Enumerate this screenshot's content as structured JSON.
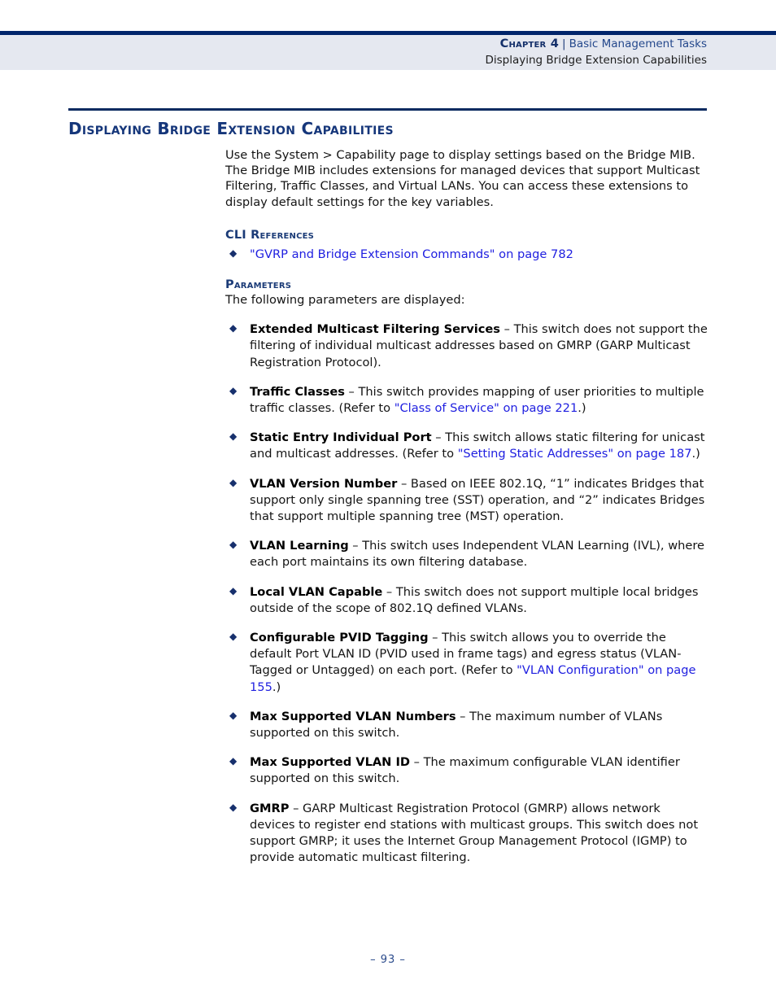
{
  "header": {
    "chapter_label": "Chapter 4",
    "separator": "|",
    "chapter_name": "Basic Management Tasks",
    "section_running": "Displaying Bridge Extension Capabilities"
  },
  "section": {
    "title": "Displaying Bridge Extension Capabilities"
  },
  "intro": {
    "paragraph": "Use the System > Capability page to display settings based on the Bridge MIB. The Bridge MIB includes extensions for managed devices that support Multicast Filtering, Traffic Classes, and Virtual LANs. You can access these extensions to display default settings for the key variables."
  },
  "cli_references": {
    "heading": "CLI References",
    "items": [
      {
        "link": "\"GVRP and Bridge Extension Commands\" on page 782"
      }
    ]
  },
  "parameters": {
    "heading": "Parameters",
    "lead_in": "The following parameters are displayed:",
    "items": [
      {
        "term": "Extended Multicast Filtering Services",
        "dash": " – ",
        "text": "This switch does not support the filtering of individual multicast addresses based on GMRP (GARP Multicast Registration Protocol)."
      },
      {
        "term": "Traffic Classes",
        "dash": " – ",
        "text": "This switch provides mapping of user priorities to multiple traffic classes. (Refer to ",
        "link": "\"Class of Service\" on page 221",
        "text_after": ".)"
      },
      {
        "term": "Static Entry Individual Port",
        "dash": " – ",
        "text": "This switch allows static filtering for unicast and multicast addresses. (Refer to ",
        "link": "\"Setting Static Addresses\" on page 187",
        "text_after": ".)"
      },
      {
        "term": "VLAN Version Number",
        "dash": " – ",
        "text": "Based on IEEE 802.1Q, “1” indicates Bridges that support only single spanning tree (SST) operation, and “2” indicates Bridges that support multiple spanning tree (MST) operation."
      },
      {
        "term": "VLAN Learning",
        "dash": " – ",
        "text": "This switch uses Independent VLAN Learning (IVL), where each port maintains its own filtering database."
      },
      {
        "term": "Local VLAN Capable",
        "dash": " – ",
        "text": "This switch does not support multiple local bridges outside of the scope of 802.1Q defined VLANs."
      },
      {
        "term": "Configurable PVID Tagging",
        "dash": " – ",
        "text": "This switch allows you to override the default Port VLAN ID (PVID used in frame tags) and egress status (VLAN-Tagged or Untagged) on each port. (Refer to ",
        "link": "\"VLAN Configuration\" on page 155",
        "text_after": ".)"
      },
      {
        "term": "Max Supported VLAN Numbers",
        "dash": " – ",
        "text": "The maximum number of VLANs supported on this switch."
      },
      {
        "term": "Max Supported VLAN ID",
        "dash": " – ",
        "text": "The maximum configurable VLAN identifier supported on this switch."
      },
      {
        "term": "GMRP",
        "dash": " – ",
        "text": "GARP Multicast Registration Protocol (GMRP) allows network devices to register end stations with multicast groups. This switch does not support GMRP; it uses the Internet Group Management Protocol (IGMP) to provide automatic multicast filtering."
      }
    ]
  },
  "footer": {
    "page_number": "–  93  –"
  },
  "bullet_glyph": "◆",
  "colors": {
    "navy_rule": "#00256b",
    "header_band": "#e5e8f0",
    "heading_blue": "#15367a",
    "link_blue": "#2020e0",
    "body_text": "#141414"
  }
}
